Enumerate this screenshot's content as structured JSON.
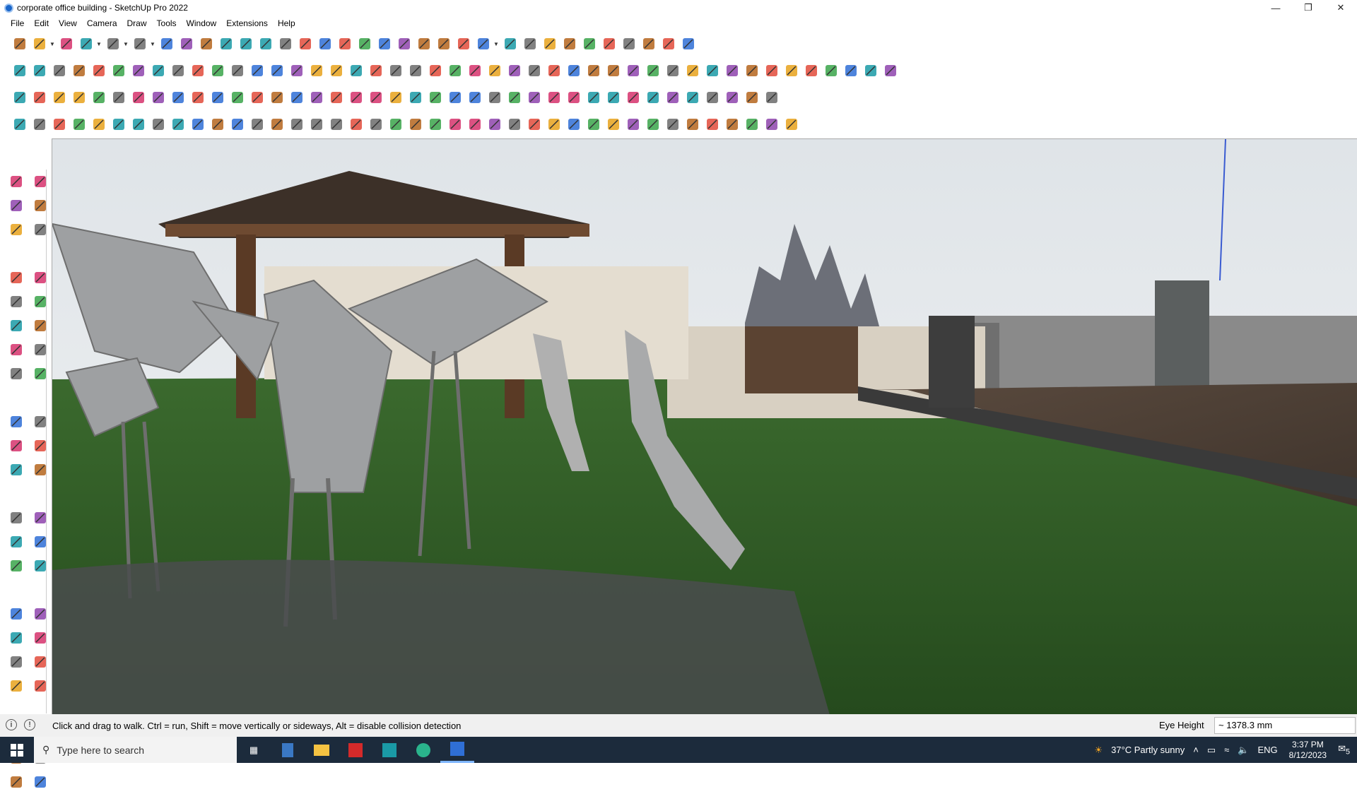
{
  "window": {
    "title": "corporate office building - SketchUp Pro 2022"
  },
  "menu": [
    "File",
    "Edit",
    "View",
    "Camera",
    "Draw",
    "Tools",
    "Window",
    "Extensions",
    "Help"
  ],
  "toolbar_rows": [
    [
      "zoom-extents-icon",
      "select-icon",
      "caret",
      "eraser-icon",
      "pencil-icon",
      "caret",
      "lasso-icon",
      "caret",
      "paint-bucket-icon",
      "caret",
      "move-icon",
      "rotate-icon",
      "push-pull-icon",
      "offset-icon",
      "scale-icon",
      "tape-icon",
      "text-icon",
      "paint-icon",
      "orbit-icon",
      "pan-icon",
      "zoom-icon",
      "zoom-window-icon",
      "section-plane-icon",
      "sandbox-icon",
      "layers-icon",
      "styles-icon",
      "person-icon",
      "caret",
      "warehouse-icon",
      "extension-icon",
      "flag-icon",
      "arrow-up-icon",
      "arrow-down-icon",
      "measure-icon",
      "cube-icon",
      "undo-icon",
      "redo-icon",
      "help-icon"
    ],
    [
      "cube-solid-icon",
      "cube-xray-icon",
      "cube-wire-icon",
      "tri-arrow-icon",
      "red-arrow-icon",
      "blue-arrow-icon",
      "green-arrow-icon",
      "orange-arrow-icon",
      "purple-arrow-icon",
      "magenta-arrow-icon",
      "curve-icon",
      "line-blue-icon",
      "line-purple-icon",
      "line-blue2-icon",
      "green-square-icon",
      "green-tree-icon",
      "house-iso-icon",
      "house-front-icon",
      "house-outline-icon",
      "house-side-icon",
      "house-top-icon",
      "house-back-icon",
      "fs-icon",
      "leaf-icon",
      "red-pencil-icon",
      "shape-rect-icon",
      "shape-circle-icon",
      "shape-hexagon-icon",
      "shape-ellipse-icon",
      "shape-parallelogram-icon",
      "shape-arc-icon",
      "shape-polygon-icon",
      "shape-star-icon",
      "shape-freeform-icon",
      "blue-loop-icon",
      "circle-loop-icon",
      "red-wand-icon",
      "pink-eraser-icon",
      "brown-block-icon",
      "grid-icon",
      "cube-dark-icon",
      "cube-stack-icon",
      "cylinder-icon",
      "box-icon",
      "red-prism-icon"
    ],
    [
      "blue-plane-icon",
      "blue-diamond-icon",
      "yellow-diamond-icon",
      "green-diamond-icon",
      "red-diamond-icon",
      "outline-diamond-icon",
      "orange-curve-icon",
      "red-square-icon",
      "window-icon",
      "page-icon",
      "wood-icon",
      "link-icon",
      "curve-thin-icon",
      "red-path-icon",
      "red-cross-icon",
      "green-cross-icon",
      "blue-x-icon",
      "green-cone-icon",
      "blue-cone-icon",
      "yellow-triangle-icon",
      "orange-c-icon",
      "orange-swirl-icon",
      "orbit-dash-icon",
      "blue-star-icon",
      "brown-cylinder-icon",
      "red-hook-icon",
      "green-cut-icon",
      "blue-gear-icon",
      "red-gear-icon",
      "pink-box-icon",
      "red-gem-icon",
      "tiles-icon",
      "chain-icon",
      "orange-grid-icon",
      "orange-grid2-icon",
      "orange-grid3-icon",
      "red-dots-icon",
      "dash-circle-icon",
      "grid-dash-icon"
    ],
    [
      "curve-node-icon",
      "spline-red-icon",
      "spline-red2-icon",
      "red-scissors-icon",
      "gear-outline-icon",
      "cloud-icon",
      "pipe-icon",
      "ring-icon",
      "rotate-gear-icon",
      "sweep-icon",
      "corner-line-icon",
      "corner-line2-icon",
      "red-line-icon",
      "red-bent-icon",
      "stairs-icon",
      "triangle-stair-icon",
      "rail-icon",
      "fence-icon",
      "round-stair-icon",
      "shell-icon",
      "arrow-left-icon",
      "layers-stair-icon",
      "slope-icon",
      "bird-icon",
      "plane-arrow-icon",
      "fold-icon",
      "stamp-icon",
      "barcode-icon",
      "ramp-icon",
      "slab-icon",
      "step-icon",
      "bars-icon",
      "grid-hatch-icon",
      "bars2-icon",
      "bars3-icon",
      "wheel-icon",
      "fan-icon",
      "ramp2-icon",
      "radial-icon",
      "house-outline-icon"
    ]
  ],
  "left_toolbar": [
    "select-icon",
    "orbit-icon",
    "paint-bucket-icon",
    "eraser-icon",
    "component-icon",
    "tape-measure-icon",
    "line-icon",
    "freehand-icon",
    "rectangle-icon",
    "rotated-rect-icon",
    "circle-icon",
    "polygon-icon",
    "arc-icon",
    "two-point-arc-icon",
    "pie-icon",
    "three-point-arc-icon",
    "move-icon",
    "push-pull-icon",
    "rotate-icon",
    "follow-me-icon",
    "scale-icon",
    "offset-icon",
    "tape-icon",
    "dimension-icon",
    "protractor-icon",
    "text-icon",
    "axes-icon",
    "3d-text-icon",
    "orbit-tool-icon",
    "pan-icon",
    "zoom-icon",
    "zoom-window-icon",
    "zoom-extents-icon",
    "previous-view-icon",
    "position-camera-icon",
    "look-around-icon",
    "walk-icon",
    "section-plane-icon",
    "sandbox-icon",
    "stamp-icon",
    "drape-icon",
    "smoove-icon"
  ],
  "status": {
    "message": "Click and drag to walk.  Ctrl = run, Shift = move vertically or sideways, Alt = disable collision detection",
    "measure_label": "Eye Height",
    "measure_value": "~ 1378.3 mm"
  },
  "taskbar": {
    "search_placeholder": "Type here to search",
    "weather": "37°C  Partly sunny",
    "lang": "ENG",
    "time": "3:37 PM",
    "date": "8/12/2023",
    "notif_count": "5"
  }
}
